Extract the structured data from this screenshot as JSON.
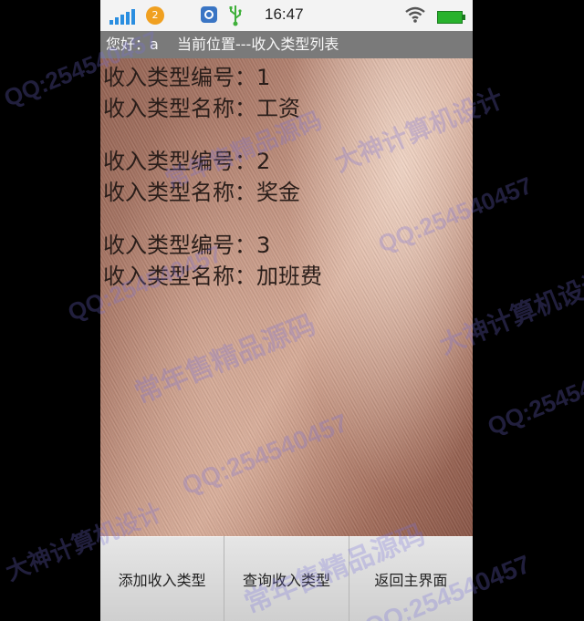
{
  "status_bar": {
    "notification_count": "2",
    "time": "16:47",
    "icons": [
      "signal-icon",
      "notification-badge-icon",
      "app-icon",
      "usb-icon",
      "wifi-icon",
      "battery-icon"
    ]
  },
  "title_bar": {
    "greeting": "您好：a",
    "location": "当前位置---收入类型列表"
  },
  "records": [
    {
      "id_line": "收入类型编号：1",
      "name_line": "收入类型名称：工资"
    },
    {
      "id_line": "收入类型编号：2",
      "name_line": "收入类型名称：奖金"
    },
    {
      "id_line": "收入类型编号：3",
      "name_line": "收入类型名称：加班费"
    }
  ],
  "buttons": {
    "add": "添加收入类型",
    "query": "查询收入类型",
    "back": "返回主界面"
  },
  "watermark": {
    "qq": "QQ:254540457",
    "slogan1": "常年售精品源码",
    "slogan2": "大神计算机设计"
  },
  "colors": {
    "status_bar_bg": "#f3f3f3",
    "title_bar_bg": "#7a7a7a",
    "button_bg": "#dcdcdc",
    "battery": "#28b22c",
    "signal": "#2a8ee0"
  }
}
